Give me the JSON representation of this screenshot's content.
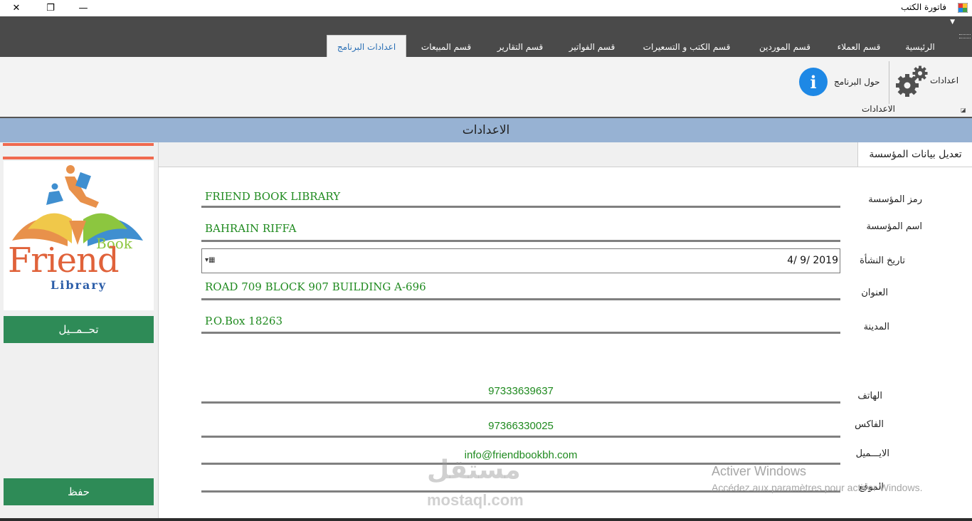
{
  "window": {
    "title": "فاتورة الكتب",
    "close_glyph": "✕",
    "restore_glyph": "❐",
    "minimize_glyph": "—"
  },
  "tabs": [
    {
      "label": "الرئيسية"
    },
    {
      "label": "قسم العملاء"
    },
    {
      "label": "قسم الموردين"
    },
    {
      "label": "قسم الكتب و التسعيرات"
    },
    {
      "label": "قسم الفواتير"
    },
    {
      "label": "قسم التقارير"
    },
    {
      "label": "قسم المبيعات"
    },
    {
      "label": "اعدادات البرنامج"
    }
  ],
  "ribbon": {
    "settings_label": "اعدادات",
    "about_label": "حول البرنامج",
    "group_label": "الاعدادات",
    "info_glyph": "i"
  },
  "header": {
    "title": "الاعدادات"
  },
  "left_panel": {
    "logo": {
      "line1": "Book",
      "line2": "Friend",
      "line3": "Library"
    },
    "load_button": "تحــمــيل",
    "save_button": "حفظ"
  },
  "form": {
    "tab_title": "تعديل بيانات المؤسسة",
    "fields": {
      "symbol": {
        "label": "رمز المؤسسة",
        "value": "FRIEND BOOK LIBRARY"
      },
      "name": {
        "label": "اسم المؤسسة",
        "value": "BAHRAIN RIFFA"
      },
      "date": {
        "label": "تاريخ النشأة",
        "value": "4/  9/ 2019"
      },
      "address": {
        "label": "العنوان",
        "value": "ROAD 709 BLOCK 907 BUILDING A-696"
      },
      "city": {
        "label": "المدينة",
        "value": "P.O.Box 18263"
      },
      "phone": {
        "label": "الهاتف",
        "value": "97333639637"
      },
      "fax": {
        "label": "الفاكس",
        "value": "97366330025"
      },
      "email": {
        "label": "الايـــميل",
        "value": "info@friendbookbh.com"
      },
      "website": {
        "label": "الموقع",
        "value": ""
      }
    }
  },
  "overlay": {
    "activate_title": "Activer Windows",
    "activate_sub": "Accédez aux paramètres pour activer Windows.",
    "mostaql_ar": "مستقل",
    "mostaql_en": "mostaql.com"
  },
  "colors": {
    "tab_bar": "#4a4a4a",
    "header_band": "#97b2d3",
    "button_green": "#2e8b57",
    "value_green": "#1f8a1f",
    "accent_orange": "#f06a4f",
    "info_blue": "#1e88e5"
  }
}
